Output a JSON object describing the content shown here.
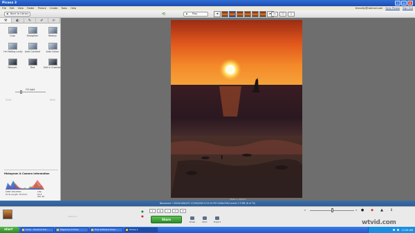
{
  "app": {
    "title": "Picasa 3"
  },
  "menu": {
    "items": [
      "File",
      "Edit",
      "View",
      "Folder",
      "Picture",
      "Create",
      "Tools",
      "Help"
    ],
    "user": "thecalty@hotmail.com",
    "signin": "Sync Picasa",
    "signout": "Sign Out"
  },
  "toolbar": {
    "back": "Back to Library",
    "play": "Play"
  },
  "panel": {
    "tabs": [
      "wrench-icon",
      "contrast-icon",
      "brush-icon",
      "pencil-icon",
      "brush-two-icon"
    ],
    "tools": [
      "Crop",
      "Straighten",
      "Redeye",
      "I'm Feeling Lucky",
      "Auto Contrast",
      "Auto Colour",
      "Retouch",
      "Text",
      "Edit in Creative Kit"
    ],
    "fill_light": {
      "label": "Fill Light",
      "value": 0.16
    },
    "undo": "Undo",
    "redo": "Redo",
    "histogram": {
      "title": "Histogram & Camera Information",
      "camera": "SONY DSC-P93A",
      "focal": "Focal Length: 35.0mm",
      "exposure": "1/6s",
      "fstop": "f/4.5",
      "iso": "ISO: 64"
    }
  },
  "caption": "Make a caption!",
  "status": "Beaumont • DSCN1086.JPG   27/09/2009 9:23:24 PM   2448x3264 pixels   2.3 MB   (8 of 70)",
  "bottom": {
    "selection": "Selection",
    "share": "Share",
    "actions": [
      "Email",
      "Print",
      "Export"
    ],
    "zoom": 0.5
  },
  "taskbar": {
    "start": "start",
    "tasks": [
      "Inbox - Personal Foll...",
      "Magazine Articles",
      "Free Software Down...",
      "Picasa 3"
    ],
    "clock": "12:06 AM"
  },
  "watermark": "wtvid.com",
  "colors": {
    "accent": "#2c8a2e",
    "title": "#2f6ed6",
    "status": "#2d5d97"
  }
}
